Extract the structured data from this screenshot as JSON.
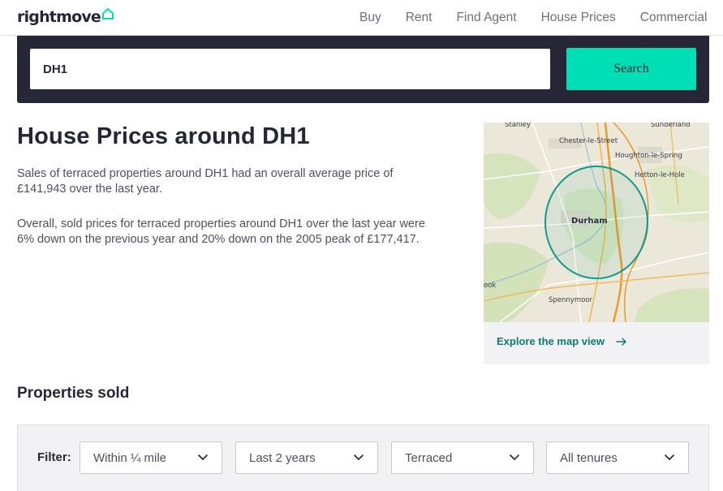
{
  "header": {
    "logo_text": "rightmove",
    "nav": [
      "Buy",
      "Rent",
      "Find Agent",
      "House Prices",
      "Commercial"
    ]
  },
  "search": {
    "value": "DH1",
    "button_label": "Search"
  },
  "main": {
    "title": "House Prices around DH1",
    "paragraph1": "Sales of terraced properties around DH1 had an overall average price of £141,943 over the last year.",
    "paragraph2": "Overall, sold prices for terraced properties around DH1 over the last year were 6% down on the previous year and 20% down on the 2005 peak of £177,417."
  },
  "map": {
    "labels": {
      "stanley": "Stanley",
      "sunderland": "Sunderland",
      "chester": "Chester-le-Street",
      "houghton": "Houghton-le-Spring",
      "hetton": "Hetton-le-Hole",
      "durham": "Durham",
      "crook": "ook",
      "spennymoor": "Spennymoor"
    },
    "link_label": "Explore the map view",
    "colors": {
      "circle": "#109c8c",
      "road": "#e89a2c",
      "land": "#e9e5d4",
      "green": "#cfe0b4"
    }
  },
  "sold": {
    "title": "Properties sold",
    "filter_label": "Filter:",
    "radius": "Within ¼ mile",
    "period": "Last 2 years",
    "type": "Terraced",
    "tenure": "All tenures"
  },
  "colors": {
    "accent": "#00deb6",
    "banner": "#262637",
    "link": "#0a7a72"
  }
}
